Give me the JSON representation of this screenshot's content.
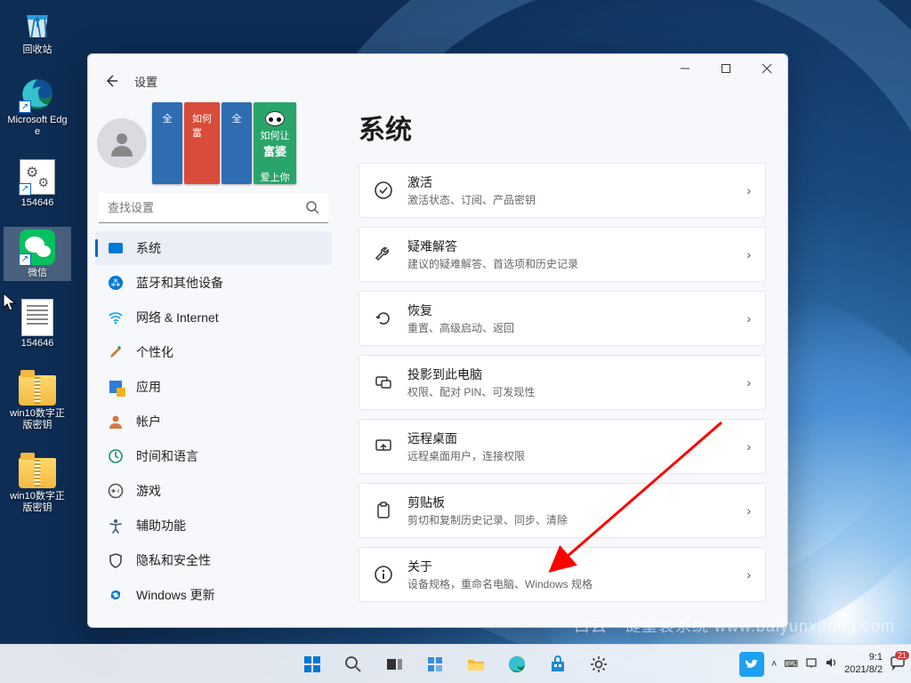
{
  "desktop": {
    "icons": [
      {
        "id": "recycle",
        "label": "回收站"
      },
      {
        "id": "edge",
        "label": "Microsoft Edge"
      },
      {
        "id": "settingsfile",
        "label": "154646"
      },
      {
        "id": "wechat",
        "label": "微信"
      },
      {
        "id": "textfile",
        "label": "154646"
      },
      {
        "id": "folder1",
        "label": "win10数字正版密钥"
      },
      {
        "id": "folder2",
        "label": "win10数字正版密钥"
      }
    ]
  },
  "window": {
    "app_title": "设置",
    "back_aria": "返回",
    "controls": {
      "min": "最小化",
      "max": "最大化",
      "close": "关闭"
    },
    "search_placeholder": "查找设置",
    "nav": [
      {
        "id": "system",
        "label": "系统",
        "active": true
      },
      {
        "id": "bluetooth",
        "label": "蓝牙和其他设备"
      },
      {
        "id": "network",
        "label": "网络 & Internet"
      },
      {
        "id": "personalization",
        "label": "个性化"
      },
      {
        "id": "apps",
        "label": "应用"
      },
      {
        "id": "accounts",
        "label": "帐户"
      },
      {
        "id": "time",
        "label": "时间和语言"
      },
      {
        "id": "gaming",
        "label": "游戏"
      },
      {
        "id": "accessibility",
        "label": "辅助功能"
      },
      {
        "id": "privacy",
        "label": "隐私和安全性"
      },
      {
        "id": "update",
        "label": "Windows 更新"
      }
    ],
    "page": {
      "heading": "系统",
      "cards": [
        {
          "id": "activation",
          "title": "激活",
          "sub": "激活状态、订阅、产品密钥"
        },
        {
          "id": "troubleshoot",
          "title": "疑难解答",
          "sub": "建议的疑难解答、首选项和历史记录"
        },
        {
          "id": "recovery",
          "title": "恢复",
          "sub": "重置、高级启动、返回"
        },
        {
          "id": "projecting",
          "title": "投影到此电脑",
          "sub": "权限、配对 PIN、可发现性"
        },
        {
          "id": "remote",
          "title": "远程桌面",
          "sub": "远程桌面用户，连接权限"
        },
        {
          "id": "clipboard",
          "title": "剪贴板",
          "sub": "剪切和复制历史记录、同步、清除"
        },
        {
          "id": "about",
          "title": "关于",
          "sub": "设备规格，重命名电脑、Windows 规格"
        }
      ]
    }
  },
  "taskbar": {
    "time": "9:1",
    "date": "2021/8/2",
    "notification_count": "21"
  },
  "watermark": "白云一键重装系统  www.baiyunxitong.com"
}
